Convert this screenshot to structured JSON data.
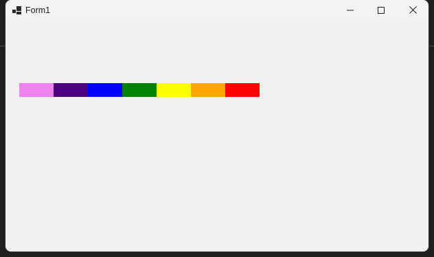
{
  "window": {
    "title": "Form1"
  },
  "titlebar": {
    "icon": "app-window-icon",
    "minimize_icon": "minimize-icon",
    "maximize_icon": "maximize-icon",
    "close_icon": "close-icon"
  },
  "swatches": [
    {
      "name": "violet",
      "color": "#ee82ee"
    },
    {
      "name": "indigo",
      "color": "#4b0082"
    },
    {
      "name": "blue",
      "color": "#0000ff"
    },
    {
      "name": "green",
      "color": "#008000"
    },
    {
      "name": "yellow",
      "color": "#ffff00"
    },
    {
      "name": "orange",
      "color": "#ffa500"
    },
    {
      "name": "red",
      "color": "#ff0000"
    }
  ]
}
